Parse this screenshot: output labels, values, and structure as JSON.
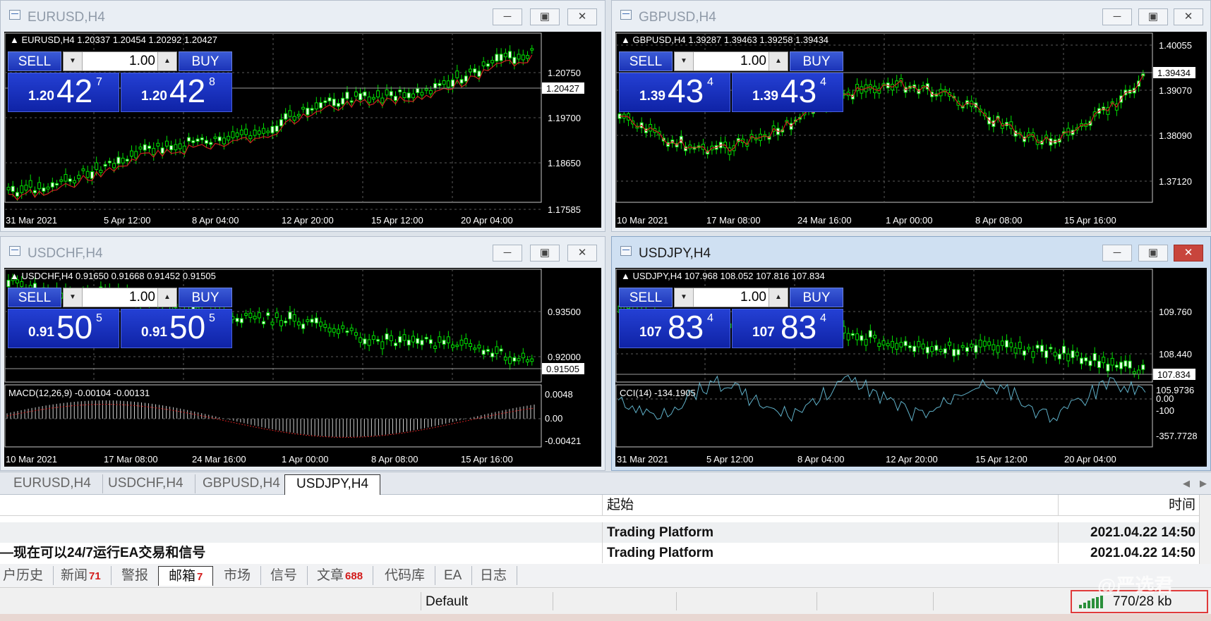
{
  "trade_panel": {
    "sell_label": "SELL",
    "buy_label": "BUY",
    "lot": "1.00",
    "down_arrow": "▼",
    "up_arrow": "▲"
  },
  "window_buttons": {
    "minimize": "─",
    "maximize": "▣",
    "close": "✕"
  },
  "windows": [
    {
      "title": "EURUSD,H4",
      "info": "EURUSD,H4  1.20337 1.20454 1.20292 1.20427",
      "sell": {
        "pre": "1.20",
        "big": "42",
        "sup": "7"
      },
      "buy": {
        "pre": "1.20",
        "big": "42",
        "sup": "8"
      },
      "price_axis": [
        "1.20750",
        "1.19700",
        "1.18650",
        "1.17585"
      ],
      "current_price": "1.20427",
      "time_axis": [
        "31 Mar 2021",
        "5 Apr 12:00",
        "8 Apr 04:00",
        "12 Apr 20:00",
        "15 Apr 12:00",
        "20 Apr 04:00"
      ]
    },
    {
      "title": "GBPUSD,H4",
      "info": "GBPUSD,H4  1.39287 1.39463 1.39258 1.39434",
      "sell": {
        "pre": "1.39",
        "big": "43",
        "sup": "4"
      },
      "buy": {
        "pre": "1.39",
        "big": "43",
        "sup": "4"
      },
      "price_axis": [
        "1.40055",
        "1.39070",
        "1.38090",
        "1.37120"
      ],
      "current_price": "1.39434",
      "time_axis": [
        "10 Mar 2021",
        "17 Mar 08:00",
        "24 Mar 16:00",
        "1 Apr 00:00",
        "8 Apr 08:00",
        "15 Apr 16:00"
      ]
    },
    {
      "title": "USDCHF,H4",
      "info": "USDCHF,H4  0.91650 0.91668 0.91452 0.91505",
      "sell": {
        "pre": "0.91",
        "big": "50",
        "sup": "5"
      },
      "buy": {
        "pre": "0.91",
        "big": "50",
        "sup": "5"
      },
      "price_axis": [
        "0.93500",
        "0.92000"
      ],
      "current_price": "0.91505",
      "indicator": "MACD(12,26,9) -0.00104 -0.00131",
      "indicator_axis": [
        "0.0048",
        "0.00",
        "-0.00421"
      ],
      "time_axis": [
        "10 Mar 2021",
        "17 Mar 08:00",
        "24 Mar 16:00",
        "1 Apr 00:00",
        "8 Apr 08:00",
        "15 Apr 16:00"
      ]
    },
    {
      "title": "USDJPY,H4",
      "info": "USDJPY,H4  107.968 108.052 107.816 107.834",
      "sell": {
        "pre": "107",
        "big": "83",
        "sup": "4"
      },
      "buy": {
        "pre": "107",
        "big": "83",
        "sup": "4"
      },
      "price_axis": [
        "109.760",
        "108.440"
      ],
      "current_price": "107.834",
      "indicator": "CCI(14) -134.1905",
      "indicator_axis": [
        "105.9736",
        "0.00",
        "-100",
        "-357.7728"
      ],
      "time_axis": [
        "31 Mar 2021",
        "5 Apr 12:00",
        "8 Apr 04:00",
        "12 Apr 20:00",
        "15 Apr 12:00",
        "20 Apr 04:00"
      ]
    }
  ],
  "chart_tabs": [
    "EURUSD,H4",
    "USDCHF,H4",
    "GBPUSD,H4",
    "USDJPY,H4"
  ],
  "active_chart_tab": "USDJPY,H4",
  "terminal": {
    "headers": {
      "from": "起始",
      "time": "时间"
    },
    "rows": [
      {
        "subject": "",
        "from": "Trading Platform",
        "time": "2021.04.22 14:50"
      },
      {
        "subject": "—现在可以24/7运行EA交易和信号",
        "from": "Trading Platform",
        "time": "2021.04.22 14:50"
      }
    ],
    "tabs": [
      {
        "label": "户历史",
        "count": ""
      },
      {
        "label": "新闻",
        "count": "71"
      },
      {
        "label": "警报",
        "count": ""
      },
      {
        "label": "邮箱",
        "count": "7"
      },
      {
        "label": "市场",
        "count": ""
      },
      {
        "label": "信号",
        "count": ""
      },
      {
        "label": "文章",
        "count": "688"
      },
      {
        "label": "代码库",
        "count": ""
      },
      {
        "label": "EA",
        "count": ""
      },
      {
        "label": "日志",
        "count": ""
      }
    ],
    "active_tab": "邮箱"
  },
  "status_bar": {
    "profile": "Default",
    "traffic": "770/28 kb"
  },
  "watermark": "@严选君",
  "colors": {
    "chart_bg": "#000000",
    "candle": "#00ff00",
    "ma": "#ff2020",
    "panel_blue": "#1c34b8",
    "alert_red": "#d21a1a"
  }
}
